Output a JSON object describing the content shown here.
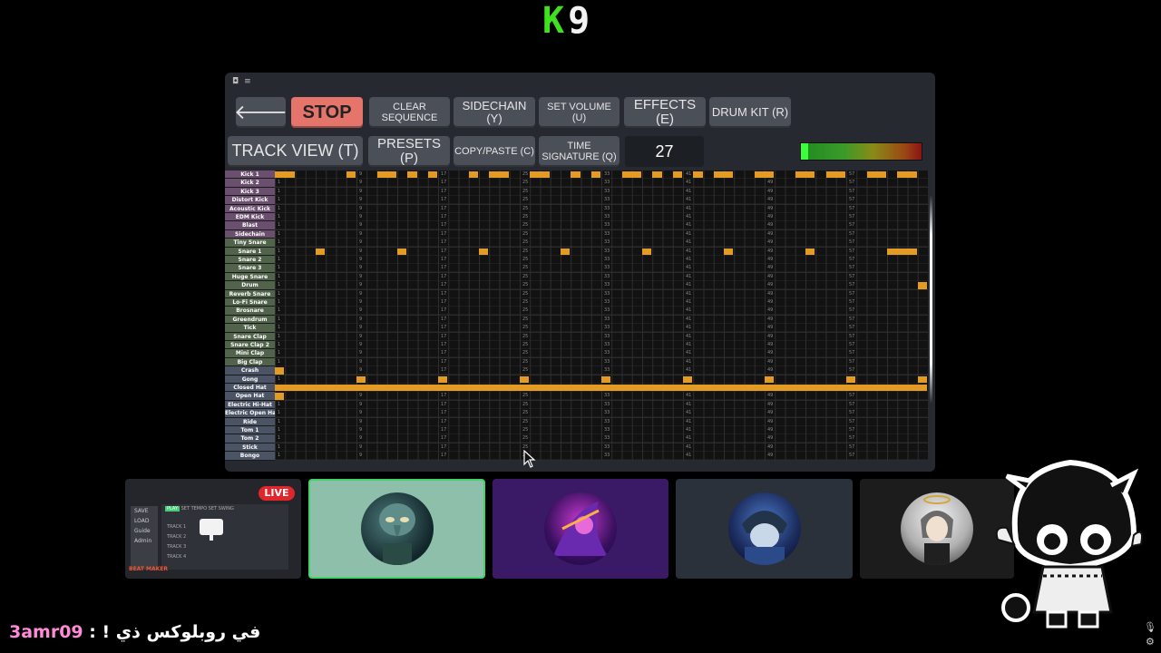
{
  "logo": {
    "k": "K",
    "n": "9"
  },
  "toolbar": {
    "back_label": "🡐",
    "stop_label": "STOP",
    "clear_label": "CLEAR SEQUENCE",
    "sidechain_label": "SIDECHAIN (Y)",
    "volume_label": "SET VOLUME (U)",
    "effects_label": "EFFECTS (E)",
    "drumkit_label": "DRUM KIT (R)",
    "trackview_label": "TRACK VIEW (T)",
    "presets_label": "PRESETS (P)",
    "copypaste_label": "COPY/PASTE (C)",
    "timesig_label": "TIME SIGNATURE (Q)",
    "tempo_value": "27",
    "volume_level": 0.06
  },
  "grid": {
    "steps": 64,
    "step_markers": [
      "1",
      "9",
      "17",
      "25",
      "33",
      "41",
      "49",
      "57"
    ],
    "note_color": "#e39b24",
    "rows": [
      {
        "label": "Kick 1",
        "color": "purple"
      },
      {
        "label": "Kick 2",
        "color": "purple"
      },
      {
        "label": "Kick 3",
        "color": "purple"
      },
      {
        "label": "Distort Kick",
        "color": "purple"
      },
      {
        "label": "Acoustic Kick",
        "color": "purple"
      },
      {
        "label": "EDM Kick",
        "color": "purple"
      },
      {
        "label": "Blast",
        "color": "purple"
      },
      {
        "label": "Sidechain",
        "color": "purple"
      },
      {
        "label": "Tiny Snare",
        "color": "green"
      },
      {
        "label": "Snare 1",
        "color": "green"
      },
      {
        "label": "Snare 2",
        "color": "green"
      },
      {
        "label": "Snare 3",
        "color": "green"
      },
      {
        "label": "Huge Snare",
        "color": "green"
      },
      {
        "label": "Drum",
        "color": "green"
      },
      {
        "label": "Reverb Snare",
        "color": "green"
      },
      {
        "label": "Lo-Fi Snare",
        "color": "green"
      },
      {
        "label": "Brosnare",
        "color": "green"
      },
      {
        "label": "Greendrum",
        "color": "green"
      },
      {
        "label": "Tick",
        "color": "green"
      },
      {
        "label": "Snare Clap",
        "color": "green"
      },
      {
        "label": "Snare Clap 2",
        "color": "green"
      },
      {
        "label": "Mini Clap",
        "color": "green"
      },
      {
        "label": "Big Clap",
        "color": "green"
      },
      {
        "label": "Crash",
        "color": "blue"
      },
      {
        "label": "Gong",
        "color": "blue"
      },
      {
        "label": "Closed Hat",
        "color": "blue"
      },
      {
        "label": "Open Hat",
        "color": "blue"
      },
      {
        "label": "Electric Hi-Hat",
        "color": "blue"
      },
      {
        "label": "Electric Open Hat",
        "color": "blue"
      },
      {
        "label": "Ride",
        "color": "blue"
      },
      {
        "label": "Tom 1",
        "color": "blue"
      },
      {
        "label": "Tom 2",
        "color": "blue"
      },
      {
        "label": "Stick",
        "color": "blue"
      },
      {
        "label": "Bongo",
        "color": "blue"
      }
    ],
    "notes": {
      "0": [
        0,
        1,
        7,
        10,
        11,
        13,
        15,
        19,
        21,
        22,
        25,
        26,
        29,
        31,
        34,
        35,
        37,
        39,
        41,
        43,
        44,
        47,
        48,
        51,
        52,
        54,
        55,
        58,
        59,
        61,
        62
      ],
      "9": [
        4,
        12,
        20,
        28,
        36,
        44,
        52,
        60,
        61,
        62
      ],
      "13": [
        63
      ],
      "23": [
        0
      ],
      "24": [
        8,
        16,
        24,
        32,
        40,
        48,
        56,
        63
      ],
      "25": [
        0,
        1,
        2,
        3,
        4,
        5,
        6,
        7,
        8,
        9,
        10,
        11,
        12,
        13,
        14,
        15,
        16,
        17,
        18,
        19,
        20,
        21,
        22,
        23,
        24,
        25,
        26,
        27,
        28,
        29,
        30,
        31,
        32,
        33,
        34,
        35,
        36,
        37,
        38,
        39,
        40,
        41,
        42,
        43,
        44,
        45,
        46,
        47,
        48,
        49,
        50,
        51,
        52,
        53,
        54,
        55,
        56,
        57,
        58,
        59,
        60,
        61,
        62,
        63
      ],
      "26": [
        0
      ]
    }
  },
  "participants": {
    "live_label": "LIVE",
    "screen_share": {
      "items": [
        "SAVE",
        "LOAD",
        "Guide",
        "Admin"
      ],
      "tabs": [
        "PLAY",
        "SET TEMPO",
        "SET SWING"
      ],
      "tracks": [
        "TRACK 1",
        "TRACK 2",
        "TRACK 3",
        "TRACK 4"
      ],
      "logo": "BEAT MAKER"
    }
  },
  "chat": {
    "username": "3amr09",
    "separator": " : ",
    "message": "في روبلوكس ذي !"
  }
}
